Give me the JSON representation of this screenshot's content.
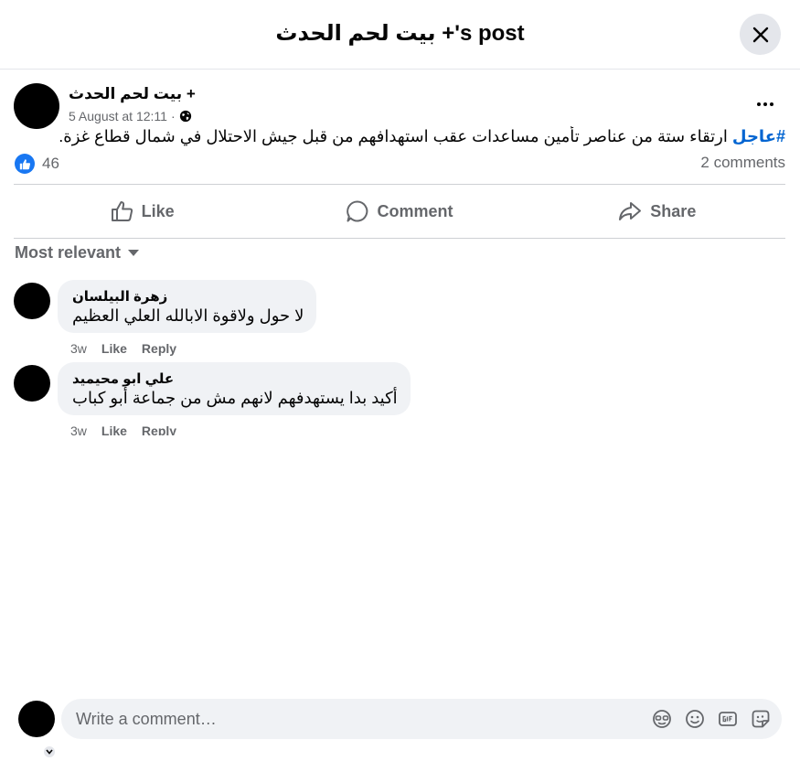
{
  "header": {
    "title": "بيت لحم الحدث +'s post"
  },
  "post": {
    "author": "بيت لحم الحدث +",
    "date": "5 August at 12:11",
    "meta_separator": "·",
    "hashtag": "#عاجل",
    "text": "ارتقاء ستة من عناصر تأمين مساعدات عقب استهدافهم من قبل جيش الاحتلال في شمال قطاع غزة.",
    "reaction_count": "46",
    "comments_count": "2 comments"
  },
  "actions": {
    "like": "Like",
    "comment": "Comment",
    "share": "Share"
  },
  "sort": {
    "label": "Most relevant"
  },
  "comments": [
    {
      "author": "زهرة البيلسان",
      "text": "لا حول ولاقوة الابالله العلي العظيم",
      "time": "3w",
      "like": "Like",
      "reply": "Reply"
    },
    {
      "author": "علي ابو محيميد",
      "text": "أكيد بدا يستهدفهم لانهم مش من جماعة أبو كباب",
      "time": "3w",
      "like": "Like",
      "reply": "Reply"
    }
  ],
  "composer": {
    "placeholder": "Write a comment…"
  },
  "icons": {
    "close": "close-icon",
    "more": "more-options-icon",
    "globe": "globe-icon",
    "like": "thumbs-up-icon",
    "comment": "comment-bubble-icon",
    "share": "share-arrow-icon",
    "avatar_stickers": "avatar-sticker-icon",
    "emoji": "emoji-icon",
    "gif": "gif-icon",
    "sticker": "sticker-icon"
  },
  "colors": {
    "accent": "#1877f2",
    "hashtag": "#0064d1",
    "secondary_text": "#65676b",
    "bubble": "#f0f2f5"
  }
}
